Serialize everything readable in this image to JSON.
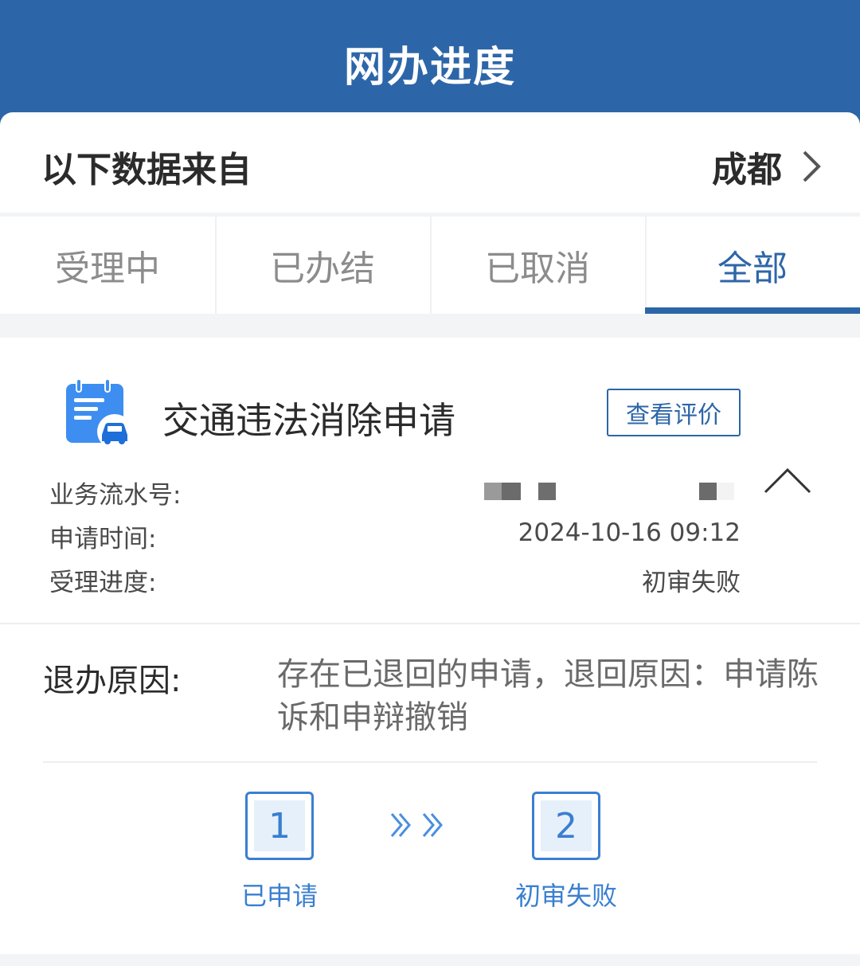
{
  "header": {
    "title": "网办进度"
  },
  "source": {
    "label": "以下数据来自",
    "city": "成都"
  },
  "tabs": [
    {
      "label": "受理中",
      "active": false
    },
    {
      "label": "已办结",
      "active": false
    },
    {
      "label": "已取消",
      "active": false
    },
    {
      "label": "全部",
      "active": true
    }
  ],
  "record": {
    "title": "交通违法消除申请",
    "review_button": "查看评价",
    "fields": {
      "serial_label": "业务流水号:",
      "time_label": "申请时间:",
      "time_value": "2024-10-16 09:12",
      "progress_label": "受理进度:",
      "progress_value": "初审失败"
    },
    "reason_label": "退办原因:",
    "reason_text": "存在已退回的申请，退回原因：申请陈诉和申辩撤销",
    "steps": [
      {
        "number": "1",
        "label": "已申请"
      },
      {
        "number": "2",
        "label": "初审失败"
      }
    ]
  },
  "colors": {
    "brand": "#2d66a8",
    "step": "#3a7fd0"
  }
}
